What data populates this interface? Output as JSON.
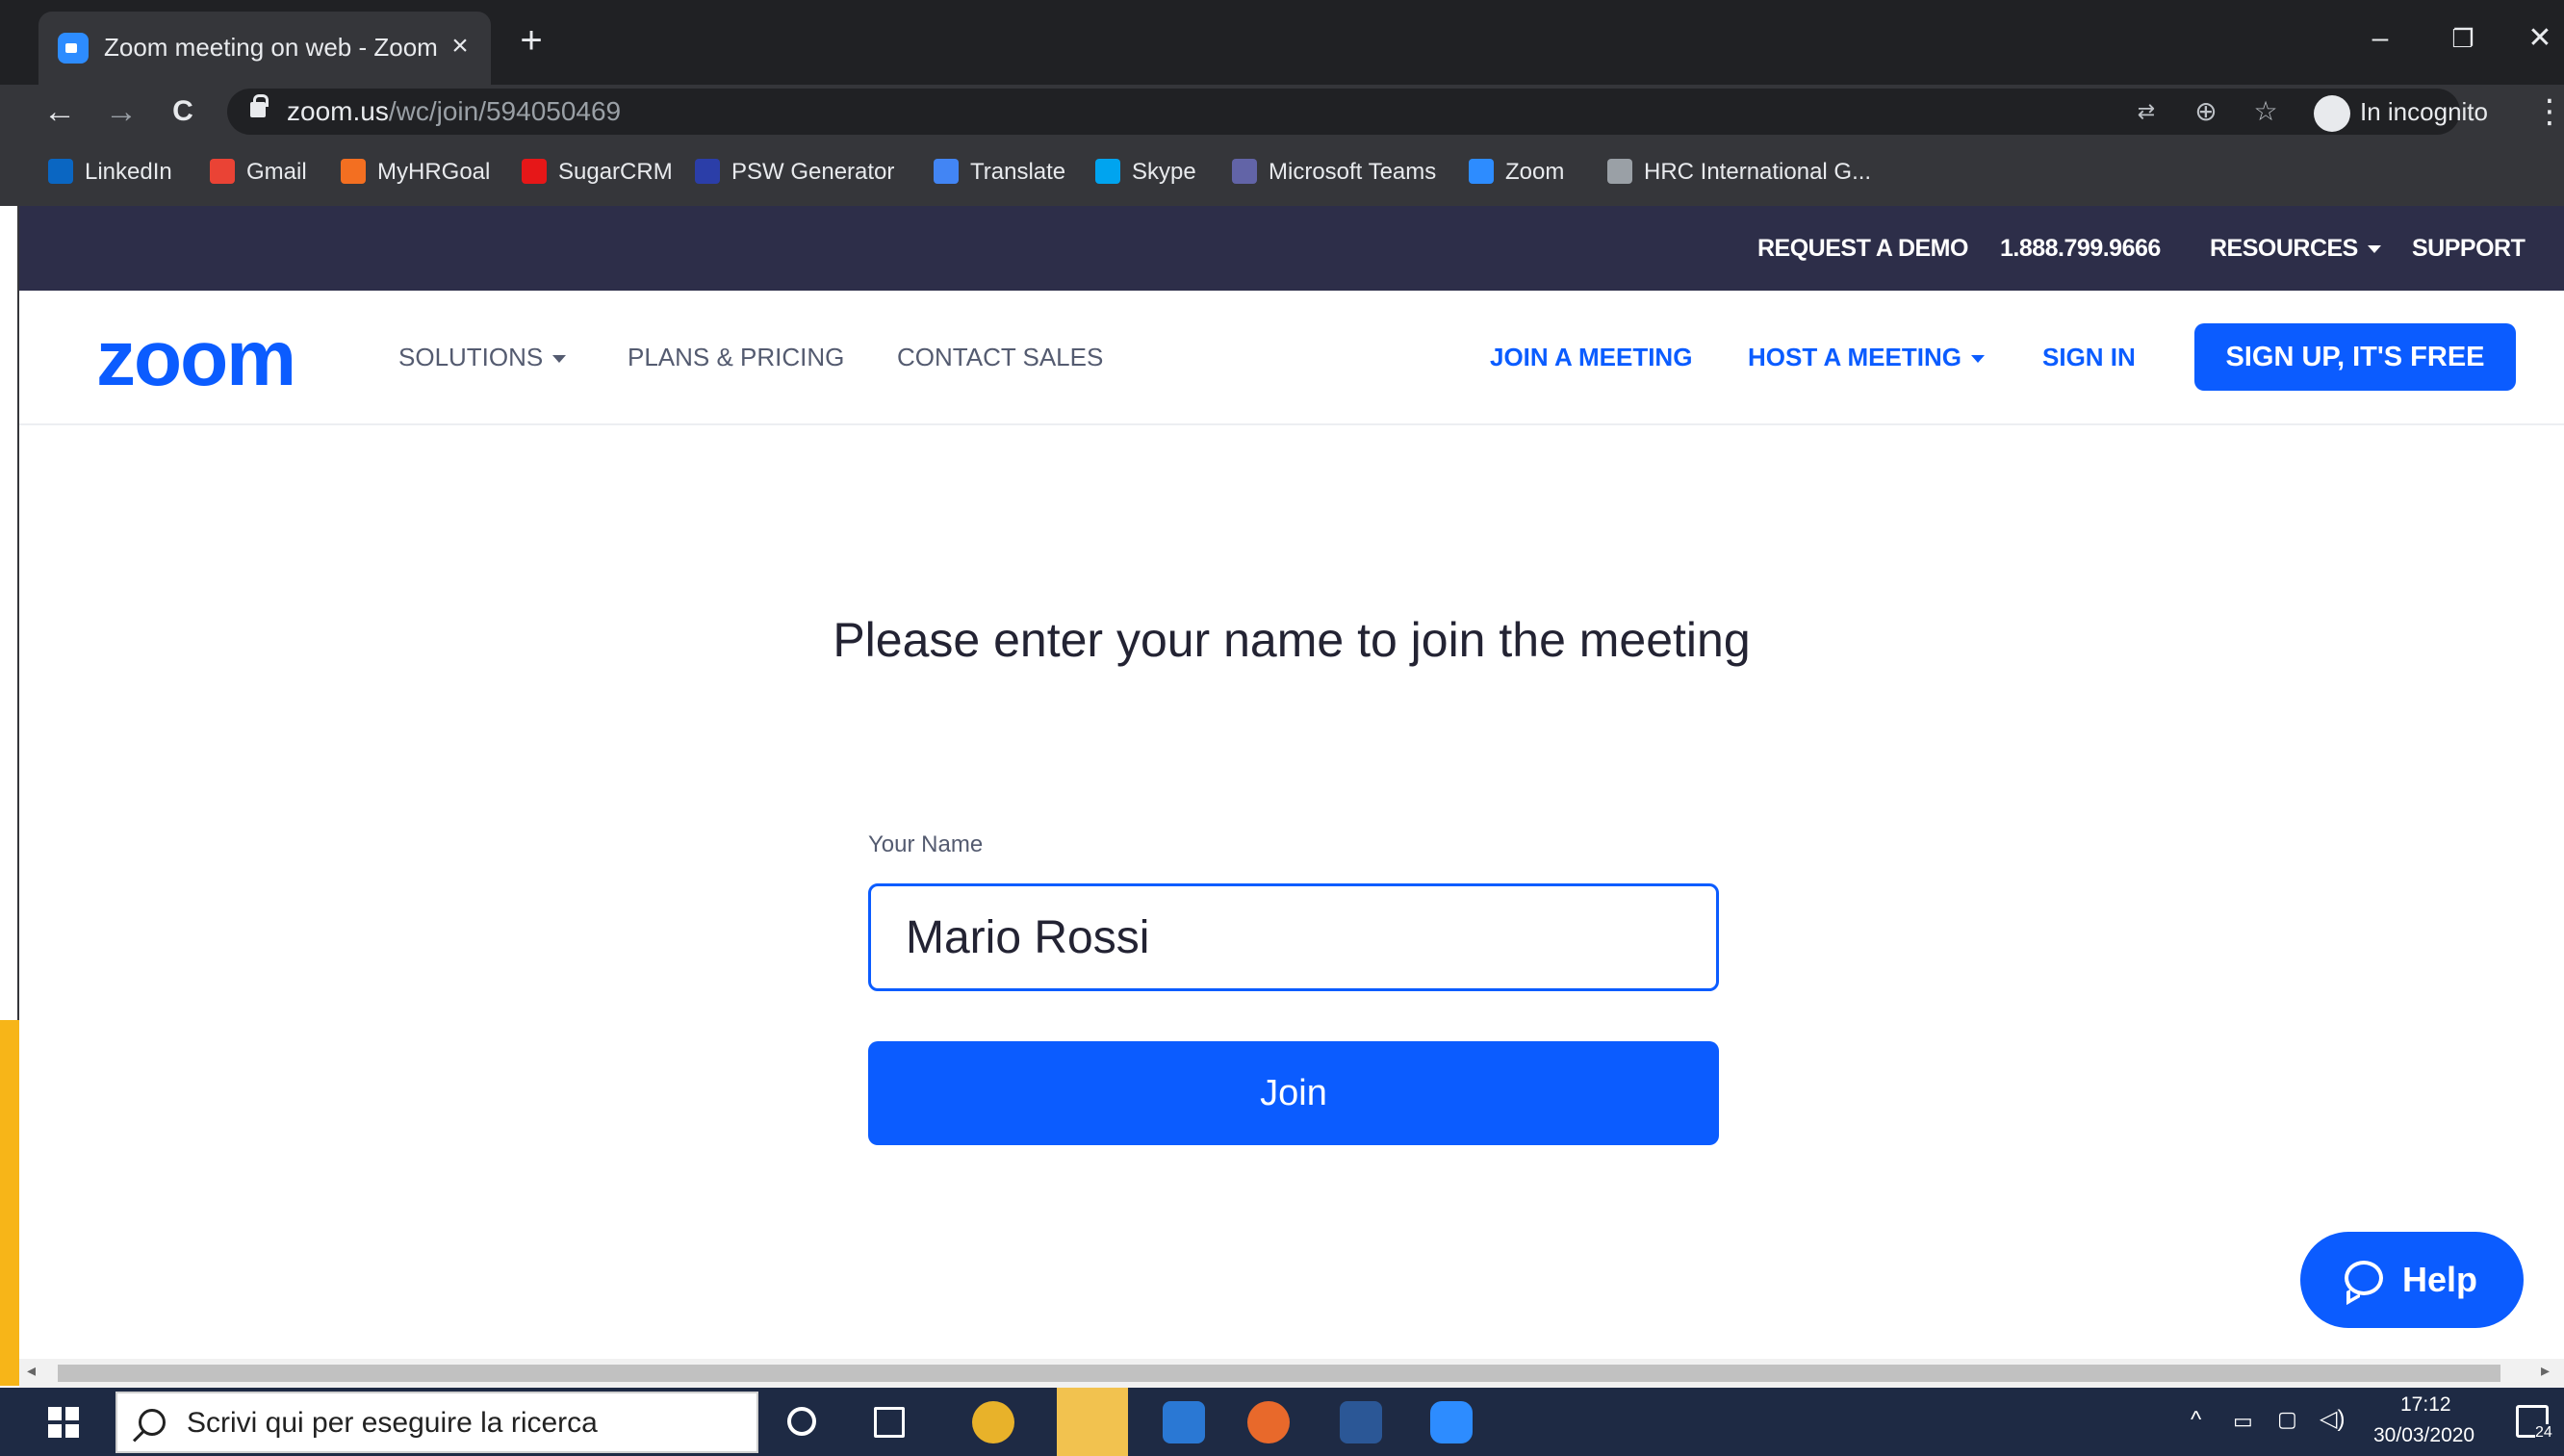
{
  "browser": {
    "tab_title": "Zoom meeting on web - Zoom",
    "tab_close": "×",
    "new_tab": "+",
    "url_host": "zoom.us",
    "url_path": "/wc/join/594050469",
    "incognito_label": "In incognito",
    "window_controls": {
      "minimize": "–",
      "restore": "❐",
      "close": "✕"
    },
    "nav": {
      "back": "←",
      "forward": "→",
      "reload": "C"
    },
    "bookmarks": [
      {
        "label": "LinkedIn",
        "icon": "linkedin-icon",
        "color": "#0a66c2"
      },
      {
        "label": "Gmail",
        "icon": "gmail-icon",
        "color": "#ea4335"
      },
      {
        "label": "MyHRGoal",
        "icon": "myhrgoal-icon",
        "color": "#f36f21"
      },
      {
        "label": "SugarCRM",
        "icon": "sugarcrm-icon",
        "color": "#e61718"
      },
      {
        "label": "PSW Generator",
        "icon": "psw-generator-icon",
        "color": "#2b3ea8"
      },
      {
        "label": "Translate",
        "icon": "google-translate-icon",
        "color": "#4285f4"
      },
      {
        "label": "Skype",
        "icon": "skype-icon",
        "color": "#00a4ef"
      },
      {
        "label": "Microsoft Teams",
        "icon": "teams-icon",
        "color": "#6264a7"
      },
      {
        "label": "Zoom",
        "icon": "zoom-icon",
        "color": "#2d8cff"
      },
      {
        "label": "HRC International G...",
        "icon": "hrc-icon",
        "color": "#9aa0a6"
      }
    ]
  },
  "zoom_site": {
    "topbar": {
      "request_demo": "REQUEST A DEMO",
      "phone": "1.888.799.9666",
      "resources": "RESOURCES",
      "support": "SUPPORT"
    },
    "logo": "zoom",
    "nav": {
      "solutions": "SOLUTIONS",
      "plans": "PLANS & PRICING",
      "contact": "CONTACT SALES",
      "join": "JOIN A MEETING",
      "host": "HOST A MEETING",
      "signin": "SIGN IN",
      "signup": "SIGN UP, IT'S FREE"
    },
    "join_form": {
      "prompt": "Please enter your name to join the meeting",
      "name_label": "Your Name",
      "name_value": "Mario Rossi",
      "join_button": "Join"
    },
    "help_button": "Help"
  },
  "taskbar": {
    "search_placeholder": "Scrivi qui per eseguire la ricerca",
    "time": "17:12",
    "date": "30/03/2020",
    "notification_count": "24"
  },
  "colors": {
    "zoom_blue": "#0b5cff",
    "topbar_navy": "#2d2e49",
    "chrome_dark": "#202124",
    "chrome_mid": "#35363a",
    "taskbar": "#1e2a44",
    "accent_yellow": "#f7b518"
  }
}
